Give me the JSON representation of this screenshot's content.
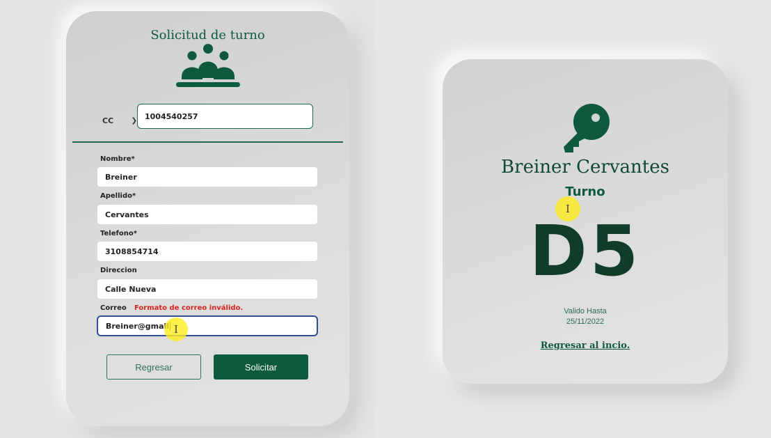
{
  "form": {
    "title": "Solicitud de turno",
    "doc_type": "CC",
    "doc_number": "1004540257",
    "fields": [
      {
        "label": "Nombre*",
        "value": "Breiner"
      },
      {
        "label": "Apellido*",
        "value": "Cervantes"
      },
      {
        "label": "Telefono*",
        "value": "3108854714"
      },
      {
        "label": "Direccion",
        "value": "Calle Nueva"
      },
      {
        "label": "Correo",
        "value": "Breiner@gmail",
        "error": "Formato de correo inválido."
      }
    ],
    "back_button": "Regresar",
    "submit_button": "Solicitar"
  },
  "ticket": {
    "name": "Breiner Cervantes",
    "label": "Turno",
    "number": "D5",
    "valid_label": "Valido Hasta",
    "valid_date": "25/11/2022",
    "back_link": "Regresar al incio."
  },
  "icons": {
    "form_header": "people-group-icon",
    "ticket_header": "key-icon",
    "select": "chevron-down-icon",
    "cursor": "text-cursor-icon"
  },
  "colors": {
    "accent": "#0c5a3c",
    "error": "#d5231d",
    "invalid_border": "#2d4f9a",
    "cursor_highlight": "#ffeb1e"
  }
}
